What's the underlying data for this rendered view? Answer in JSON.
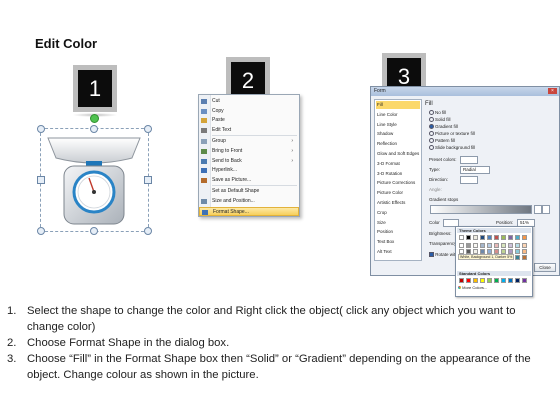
{
  "page_title": "Edit Color",
  "steps": [
    "1",
    "2",
    "3"
  ],
  "context_menu": {
    "items": [
      {
        "label": "Cut",
        "icon": "scissors-icon"
      },
      {
        "label": "Copy",
        "icon": "copy-icon"
      },
      {
        "label": "Paste",
        "icon": "paste-icon"
      },
      {
        "label": "Edit Text",
        "icon": "edit-text-icon"
      },
      {
        "label": "Group",
        "icon": "group-icon",
        "submenu": true
      },
      {
        "label": "Bring to Front",
        "icon": "bring-front-icon",
        "submenu": true
      },
      {
        "label": "Send to Back",
        "icon": "send-back-icon",
        "submenu": true
      },
      {
        "label": "Hyperlink...",
        "icon": "hyperlink-icon"
      },
      {
        "label": "Save as Picture...",
        "icon": "save-picture-icon"
      },
      {
        "label": "Set as Default Shape",
        "icon": ""
      },
      {
        "label": "Size and Position...",
        "icon": "size-position-icon"
      },
      {
        "label": "Format Shape...",
        "icon": "format-shape-icon",
        "highlighted": true
      }
    ]
  },
  "dialog": {
    "title": "Form",
    "close": "×",
    "categories": [
      "Fill",
      "Line Color",
      "Line Style",
      "Shadow",
      "Reflection",
      "Glow and Soft Edges",
      "3-D Format",
      "3-D Rotation",
      "Picture Corrections",
      "Picture Color",
      "Artistic Effects",
      "Crop",
      "Size",
      "Position",
      "Text Box",
      "Alt Text"
    ],
    "section": "Fill",
    "fill_options": [
      "No fill",
      "Solid fill",
      "Gradient fill",
      "Picture or texture fill",
      "Pattern fill",
      "Slide background fill"
    ],
    "preset_label": "Preset colors:",
    "type_label": "Type:",
    "type_value": "Radial",
    "direction_label": "Direction:",
    "angle_label": "Angle:",
    "gradient_stops_label": "Gradient stops",
    "color_label": "Color",
    "position_label": "Position:",
    "position_value": "51%",
    "brightness_label": "Brightness:",
    "transparency_label": "Transparency:",
    "rotate_label": "Rotate with shape",
    "close_button": "Close"
  },
  "palette": {
    "theme_header": "Theme Colors",
    "tooltip": "White, Background 1, Darker 5%",
    "standard_header": "Standard Colors",
    "more": "More Colors...",
    "theme_top": [
      "#ffffff",
      "#000000",
      "#eeece1",
      "#1f497d",
      "#4f81bd",
      "#c0504d",
      "#9bbb59",
      "#8064a2",
      "#4bacc6",
      "#f79646"
    ],
    "standard": [
      "#c00000",
      "#ff0000",
      "#ffc000",
      "#ffff00",
      "#92d050",
      "#00b050",
      "#00b0f0",
      "#0070c0",
      "#002060",
      "#7030a0"
    ]
  },
  "instructions": [
    {
      "num": "1.",
      "text": "Select the shape to change the color and Right click the object( click any object which you want to change color)"
    },
    {
      "num": "2.",
      "text": "Choose Format Shape in the dialog box."
    },
    {
      "num": "3.",
      "text": "Choose “Fill” in the Format Shape box then “Solid” or “Gradient” depending on the appearance of the object. Change colour as shown in the picture."
    }
  ]
}
